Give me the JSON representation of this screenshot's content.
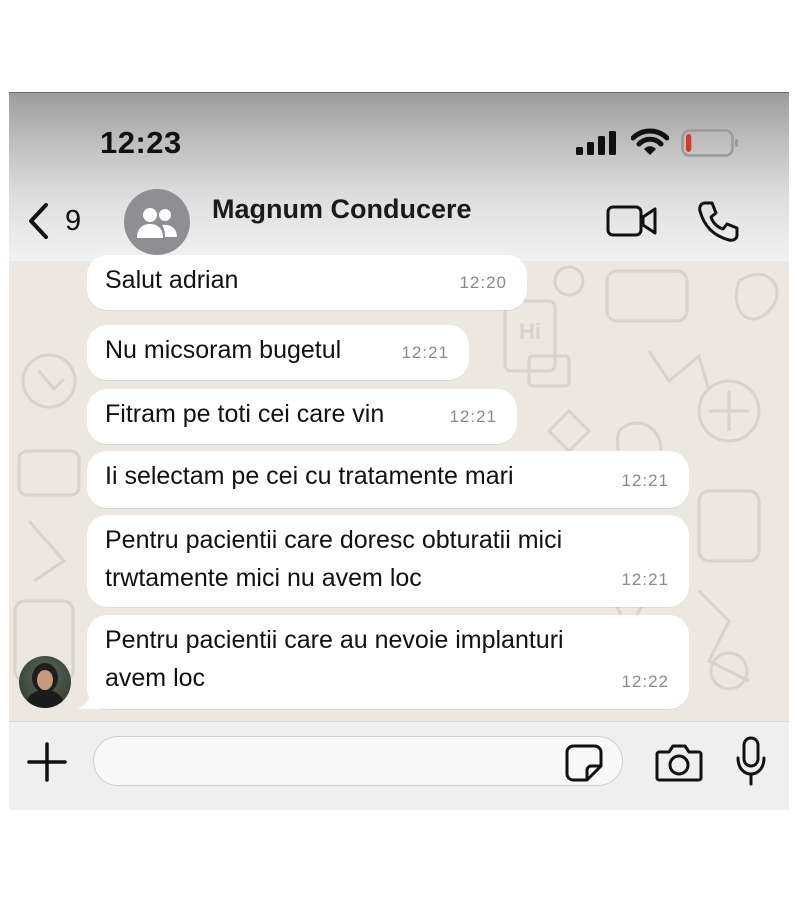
{
  "status_bar": {
    "time": "12:23",
    "battery_level": 0.12,
    "battery_color": "#d9362c"
  },
  "header": {
    "back_count": "9",
    "chat_title": "Magnum Conducere",
    "avatar_icon": "group-icon",
    "icons": [
      "chevron-left-icon",
      "video-call-icon",
      "phone-call-icon"
    ]
  },
  "messages": [
    {
      "text": "Salut adrian",
      "time": "12:20"
    },
    {
      "text": "Nu micsoram bugetul",
      "time": "12:21"
    },
    {
      "text": "Fitram pe toti cei care vin",
      "time": "12:21"
    },
    {
      "text": "Ii selectam pe cei cu tratamente mari",
      "time": "12:21"
    },
    {
      "text_lines": [
        "Pentru pacientii care doresc obturatii mici",
        "trwtamente mici nu avem loc"
      ],
      "time": "12:21"
    },
    {
      "text_lines": [
        "Pentru pacientii care au nevoie implanturi",
        "avem loc"
      ],
      "time": "12:22"
    }
  ],
  "composer": {
    "input_value": "",
    "icons": [
      "plus-icon",
      "sticker-icon",
      "camera-icon",
      "microphone-icon"
    ]
  },
  "colors": {
    "bubble": "#ffffff",
    "wallpaper": "#ece7df",
    "timestamp": "#8a8a8a"
  }
}
